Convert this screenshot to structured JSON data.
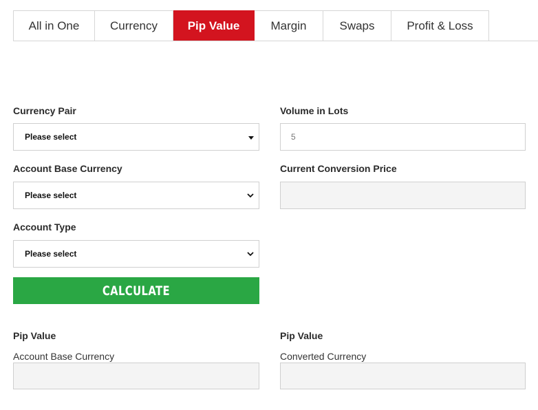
{
  "tabs": [
    {
      "label": "All in One",
      "active": false
    },
    {
      "label": "Currency",
      "active": false
    },
    {
      "label": "Pip Value",
      "active": true
    },
    {
      "label": "Margin",
      "active": false
    },
    {
      "label": "Swaps",
      "active": false
    },
    {
      "label": "Profit & Loss",
      "active": false
    }
  ],
  "form": {
    "currency_pair": {
      "label": "Currency Pair",
      "value": "Please select"
    },
    "volume": {
      "label": "Volume in Lots",
      "placeholder": "5"
    },
    "account_base_currency": {
      "label": "Account Base Currency",
      "value": "Please select"
    },
    "conversion_price": {
      "label": "Current Conversion Price",
      "value": ""
    },
    "account_type": {
      "label": "Account Type",
      "value": "Please select"
    }
  },
  "calculate_label": "CALCULATE",
  "results": {
    "left": {
      "label": "Pip Value",
      "sublabel": "Account Base Currency",
      "value": ""
    },
    "right": {
      "label": "Pip Value",
      "sublabel": "Converted Currency",
      "value": ""
    }
  },
  "colors": {
    "active_tab": "#d3141f",
    "button": "#2aa744"
  }
}
